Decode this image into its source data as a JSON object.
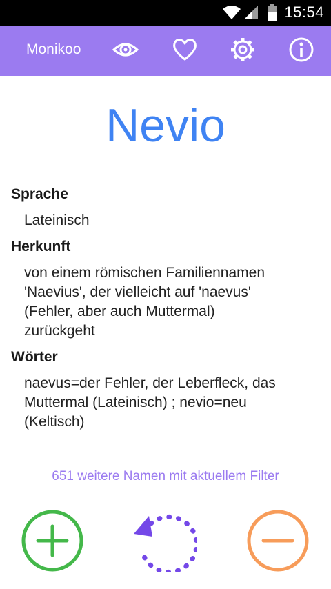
{
  "status_bar": {
    "time": "15:54"
  },
  "app_bar": {
    "title": "Monikoo",
    "icons": [
      "eye-icon",
      "heart-icon",
      "gear-icon",
      "info-icon"
    ]
  },
  "name": "Nevio",
  "sections": {
    "language": {
      "label": "Sprache",
      "value": "Lateinisch"
    },
    "origin": {
      "label": "Herkunft",
      "lines": [
        "von einem römischen Familiennamen",
        "'Naevius', der vielleicht auf 'naevus'",
        "(Fehler, aber auch Muttermal)",
        "zurückgeht"
      ]
    },
    "words": {
      "label": "Wörter",
      "lines": [
        "naevus=der Fehler, der Leberfleck, das",
        "Muttermal (Lateinisch) ; nevio=neu",
        "(Keltisch)"
      ]
    }
  },
  "filter_info": "651 weitere Namen mit aktuellem Filter",
  "actions": {
    "add_color": "#44b84a",
    "undo_color": "#7448e8",
    "remove_color": "#f79c5a"
  },
  "colors": {
    "app_bar": "#9b7bf0",
    "name": "#3f83f3"
  }
}
